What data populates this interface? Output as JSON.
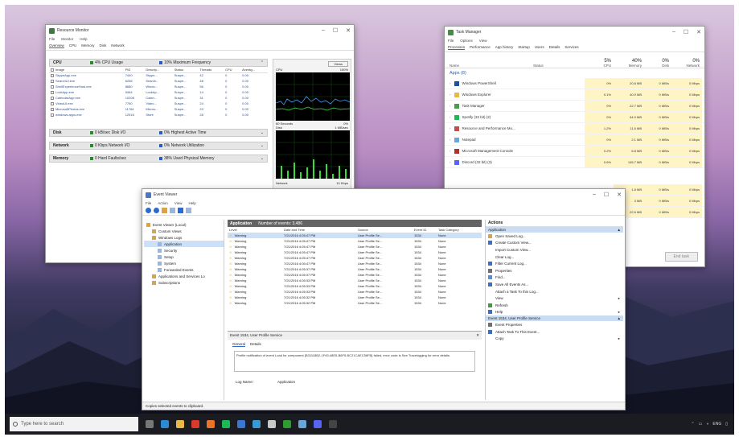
{
  "resource_monitor": {
    "title": "Resource Monitor",
    "menu": [
      "File",
      "Monitor",
      "Help"
    ],
    "tabs": [
      "Overview",
      "CPU",
      "Memory",
      "Disk",
      "Network"
    ],
    "cpu_header": "CPU",
    "cpu_usage": "4% CPU Usage",
    "cpu_freq": "10% Maximum Frequency",
    "columns": [
      "Image",
      "PID",
      "Descrip...",
      "Status",
      "Threads",
      "CPU",
      "Averag..."
    ],
    "rows": [
      [
        "SkypeApp.exe",
        "7440",
        "Skype...",
        "Suspe...",
        "42",
        "0",
        "0.00"
      ],
      [
        "SearchUI.exe",
        "6256",
        "Search...",
        "Suspe...",
        "48",
        "0",
        "0.00"
      ],
      [
        "ShellExperienceHost.exe",
        "8680",
        "Windo...",
        "Suspe...",
        "56",
        "0",
        "0.00"
      ],
      [
        "LockApp.exe",
        "5464",
        "LockAp...",
        "Suspe...",
        "14",
        "0",
        "0.00"
      ],
      [
        "CalendarApp.exe",
        "10208",
        "Calen...",
        "Suspe...",
        "31",
        "0",
        "0.00"
      ],
      [
        "VideoUI.exe",
        "7760",
        "Video...",
        "Suspe...",
        "24",
        "0",
        "0.00"
      ],
      [
        "MicrosoftPhotos.exe",
        "11764",
        "Micros...",
        "Suspe...",
        "23",
        "0",
        "0.00"
      ],
      [
        "windows.apps.exe",
        "12516",
        "Store",
        "Suspe...",
        "28",
        "0",
        "0.00"
      ]
    ],
    "disk_header": "Disk",
    "disk_a": "0 kB/sec Disk I/O",
    "disk_b": "0% Highest Active Time",
    "net_header": "Network",
    "net_a": "0 Kbps Network I/O",
    "net_b": "0% Network Utilization",
    "mem_header": "Memory",
    "mem_a": "0 Hard Faults/sec",
    "mem_b": "38% Used Physical Memory",
    "views_label": "Views",
    "graph_cpu": "CPU",
    "graph_cpu_pct": "100%",
    "graph_60s": "60 Seconds",
    "graph_0": "0%",
    "graph_disk": "Disk",
    "graph_disk_val": "1 MB/sec",
    "graph_net": "Network",
    "graph_net_val": "10 Kbps"
  },
  "task_manager": {
    "title": "Task Manager",
    "menu": [
      "File",
      "Options",
      "View"
    ],
    "tabs": [
      "Processes",
      "Performance",
      "App history",
      "Startup",
      "Users",
      "Details",
      "Services"
    ],
    "header_pcts": [
      "5%",
      "40%",
      "0%",
      "0%"
    ],
    "columns": [
      "Name",
      "Status",
      "CPU",
      "Memory",
      "Disk",
      "Network"
    ],
    "group": "Apps (8)",
    "apps": [
      {
        "name": "Windows PowerShell",
        "cpu": "0%",
        "mem": "20.8 MB",
        "disk": "0 MB/s",
        "net": "0 Mbps",
        "color": "#1f4e9e"
      },
      {
        "name": "Windows Explorer",
        "cpu": "0.1%",
        "mem": "40.9 MB",
        "disk": "0 MB/s",
        "net": "0 Mbps",
        "color": "#e8b84a"
      },
      {
        "name": "Task Manager",
        "cpu": "0%",
        "mem": "22.7 MB",
        "disk": "0 MB/s",
        "net": "0 Mbps",
        "color": "#4a9b4a"
      },
      {
        "name": "Spotify (32 bit) (2)",
        "cpu": "0%",
        "mem": "64.9 MB",
        "disk": "0 MB/s",
        "net": "0 Mbps",
        "color": "#1db954"
      },
      {
        "name": "Resource and Performance Mo...",
        "cpu": "1.2%",
        "mem": "11.6 MB",
        "disk": "0 MB/s",
        "net": "0 Mbps",
        "color": "#c0504d"
      },
      {
        "name": "Notepad",
        "cpu": "0%",
        "mem": "2.1 MB",
        "disk": "0 MB/s",
        "net": "0 Mbps",
        "color": "#6aa6d8"
      },
      {
        "name": "Microsoft Management Console",
        "cpu": "0.2%",
        "mem": "6.8 MB",
        "disk": "0 MB/s",
        "net": "0 Mbps",
        "color": "#b03030"
      },
      {
        "name": "Discord (32 bit) (3)",
        "cpu": "0.6%",
        "mem": "145.7 MB",
        "disk": "0 MB/s",
        "net": "0 Mbps",
        "color": "#5865f2"
      }
    ],
    "lower_rows": [
      {
        "mem": "1.8 MB",
        "disk": "0 MB/s",
        "net": "0 Mbps"
      },
      {
        "mem": "3 MB",
        "disk": "0 MB/s",
        "net": "0 Mbps"
      },
      {
        "mem": "22.6 MB",
        "disk": "0 MB/s",
        "net": "0 Mbps"
      }
    ],
    "end_task": "End task"
  },
  "event_viewer": {
    "title": "Event Viewer",
    "menu": [
      "File",
      "Action",
      "View",
      "Help"
    ],
    "tree": [
      {
        "label": "Event Viewer (Local)",
        "indent": 0
      },
      {
        "label": "Custom Views",
        "indent": 1
      },
      {
        "label": "Windows Logs",
        "indent": 1
      },
      {
        "label": "Application",
        "indent": 2,
        "selected": true
      },
      {
        "label": "Security",
        "indent": 2
      },
      {
        "label": "Setup",
        "indent": 2
      },
      {
        "label": "System",
        "indent": 2
      },
      {
        "label": "Forwarded Events",
        "indent": 2
      },
      {
        "label": "Applications and Services Lo",
        "indent": 1
      },
      {
        "label": "Subscriptions",
        "indent": 1
      }
    ],
    "center_header": "Application",
    "center_count": "Number of events: 3,486",
    "columns": [
      "Level",
      "Date and Time",
      "Source",
      "Event ID",
      "Task Category"
    ],
    "events": [
      [
        "Warning",
        "7/21/2016 4:05:47 PM",
        "User Profile Se...",
        "1534",
        "None"
      ],
      [
        "Warning",
        "7/21/2016 4:05:47 PM",
        "User Profile Se...",
        "1534",
        "None"
      ],
      [
        "Warning",
        "7/21/2016 4:05:47 PM",
        "User Profile Se...",
        "1534",
        "None"
      ],
      [
        "Warning",
        "7/21/2016 4:05:47 PM",
        "User Profile Se...",
        "1534",
        "None"
      ],
      [
        "Warning",
        "7/21/2016 4:05:47 PM",
        "User Profile Se...",
        "1534",
        "None"
      ],
      [
        "Warning",
        "7/21/2016 4:05:47 PM",
        "User Profile Se...",
        "1534",
        "None"
      ],
      [
        "Warning",
        "7/21/2016 4:05:37 PM",
        "User Profile Se...",
        "1534",
        "None"
      ],
      [
        "Warning",
        "7/21/2016 4:05:37 PM",
        "User Profile Se...",
        "1534",
        "None"
      ],
      [
        "Warning",
        "7/21/2016 4:05:33 PM",
        "User Profile Se...",
        "1534",
        "None"
      ],
      [
        "Warning",
        "7/21/2016 4:05:33 PM",
        "User Profile Se...",
        "1534",
        "None"
      ],
      [
        "Warning",
        "7/21/2016 4:05:33 PM",
        "User Profile Se...",
        "1534",
        "None"
      ],
      [
        "Warning",
        "7/21/2016 4:05:32 PM",
        "User Profile Se...",
        "1534",
        "None"
      ],
      [
        "Warning",
        "7/21/2016 4:05:32 PM",
        "User Profile Se...",
        "1534",
        "None"
      ]
    ],
    "detail_title": "Event 1534, User Profile Service",
    "detail_tabs": [
      "General",
      "Details"
    ],
    "detail_text": "Profile notification of event Load for component {B31118B2-1F49-48E5-B6F5-BC21CAEC56FB} failed, error code is See Tracelogging for error details.",
    "detail_log_label": "Log Name:",
    "detail_log_value": "Application",
    "actions_header": "Actions",
    "actions_group1": "Application",
    "actions1": [
      {
        "label": "Open Saved Log...",
        "icon": "#d9a441"
      },
      {
        "label": "Create Custom View...",
        "icon": "#3a6fc9"
      },
      {
        "label": "Import Custom View...",
        "icon": ""
      },
      {
        "label": "Clear Log...",
        "icon": ""
      },
      {
        "label": "Filter Current Log...",
        "icon": "#3a6fc9"
      },
      {
        "label": "Properties",
        "icon": "#6f6f6f"
      },
      {
        "label": "Find...",
        "icon": "#5a8ed6"
      },
      {
        "label": "Save All Events As...",
        "icon": "#3a6fc9"
      },
      {
        "label": "Attach a Task To this Log...",
        "icon": ""
      },
      {
        "label": "View",
        "icon": "",
        "arrow": true
      },
      {
        "label": "Refresh",
        "icon": "#3d9d3d"
      },
      {
        "label": "Help",
        "icon": "#3a6fc9",
        "arrow": true
      }
    ],
    "actions_group2": "Event 1534, User Profile Service",
    "actions2": [
      {
        "label": "Event Properties",
        "icon": "#6f6f6f"
      },
      {
        "label": "Attach Task To This Event...",
        "icon": "#3a6fc9"
      },
      {
        "label": "Copy",
        "icon": "",
        "arrow": true
      }
    ],
    "status_bar": "Copies selected events to clipboard."
  },
  "taskbar": {
    "search_placeholder": "Type here to search",
    "icons": [
      "task-view-icon",
      "edge-icon",
      "file-explorer-icon",
      "chrome-icon",
      "firefox-icon",
      "spotify-icon",
      "store-icon",
      "photos-icon",
      "event-viewer-icon",
      "perfmon-icon",
      "notepad-icon",
      "discord-icon",
      "cmd-icon"
    ],
    "icon_colors": [
      "#777",
      "#2a8ad4",
      "#e8b84a",
      "#d93a2b",
      "#e8742a",
      "#1db954",
      "#3a77d4",
      "#3a9bd4",
      "#c9c9c9",
      "#2f9c2f",
      "#6aa6d8",
      "#5865f2",
      "#444"
    ],
    "tray_text": "ENG"
  }
}
